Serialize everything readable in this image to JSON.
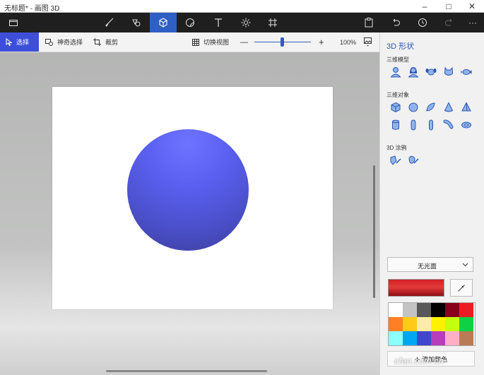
{
  "window": {
    "title": "无标题* - 画图 3D",
    "minimize": "–",
    "maximize": "□",
    "close": "✕"
  },
  "ribbon": {
    "tools": [
      "brush-icon",
      "2d-shapes-icon",
      "3d-shapes-icon",
      "stickers-icon",
      "text-icon",
      "effects-icon",
      "canvas-icon"
    ],
    "active_tool": "3d-shapes-icon",
    "right_tools": [
      "paste-icon",
      "undo-icon",
      "history-icon",
      "redo-icon",
      "more-icon"
    ],
    "more_label": "···"
  },
  "toolbar": {
    "select_label": "选择",
    "magic_select_label": "神奇选择",
    "crop_label": "裁剪",
    "toggle_view_label": "切换视图",
    "zoom_minus": "—",
    "zoom_plus": "+",
    "zoom_value": 100,
    "zoom_label": "100%"
  },
  "panel": {
    "title": "3D 形状",
    "models_label": "三维模型",
    "models": [
      "man-icon",
      "woman-icon",
      "dog-icon",
      "cat-icon",
      "fish-icon"
    ],
    "objects_label": "三维对象",
    "objects_row1": [
      "cube-icon",
      "sphere-icon",
      "hemisphere-icon",
      "cone-icon",
      "pyramid-icon"
    ],
    "objects_row2": [
      "cylinder-icon",
      "capsule-icon",
      "tube-icon",
      "bent-tube-icon",
      "torus-icon"
    ],
    "doodle_label": "3D 涂鸦",
    "doodles": [
      "sharp-doodle-icon",
      "soft-doodle-icon"
    ],
    "finish_dropdown": "无光面",
    "current_color": "#d42a2a",
    "palette": [
      "#ffffff",
      "#c3c3c3",
      "#585858",
      "#000000",
      "#88001b",
      "#ec1c24",
      "#ff7f27",
      "#ffca18",
      "#fdeca6",
      "#fff200",
      "#c4ff0e",
      "#0ed145",
      "#8cfffb",
      "#00a8f3",
      "#3f48cc",
      "#b83dba",
      "#ffaec8",
      "#b97a56"
    ],
    "add_color_label": "添加颜色"
  },
  "watermark": "cfan.com.cn",
  "colors": {
    "accent": "#3d4fd9",
    "ribbon_bg": "#1f1f1f",
    "sphere": "#5a5ff0"
  }
}
